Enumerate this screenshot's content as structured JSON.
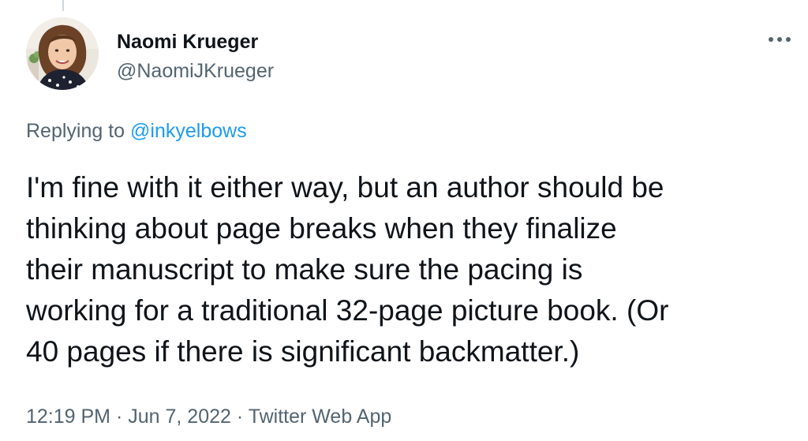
{
  "author": {
    "name": "Naomi Krueger",
    "handle": "@NaomiJKrueger"
  },
  "reply": {
    "prefix": "Replying to",
    "mention": "@inkyelbows"
  },
  "tweet": {
    "lines": [
      "I'm fine with it either way, but an author should be",
      "thinking about page breaks when they finalize",
      "their manuscript to make sure the pacing is",
      "working for a traditional 32-page picture book. (Or",
      "40 pages if there is significant backmatter.)"
    ]
  },
  "meta": {
    "time": "12:19 PM",
    "separator": "·",
    "date": "Jun 7, 2022",
    "source": "Twitter Web App"
  },
  "icons": {
    "more": "more-dots-icon",
    "avatar": "profile-photo"
  },
  "colors": {
    "primary_text": "#0f1419",
    "secondary_text": "#536471",
    "link": "#1d9bf0"
  }
}
